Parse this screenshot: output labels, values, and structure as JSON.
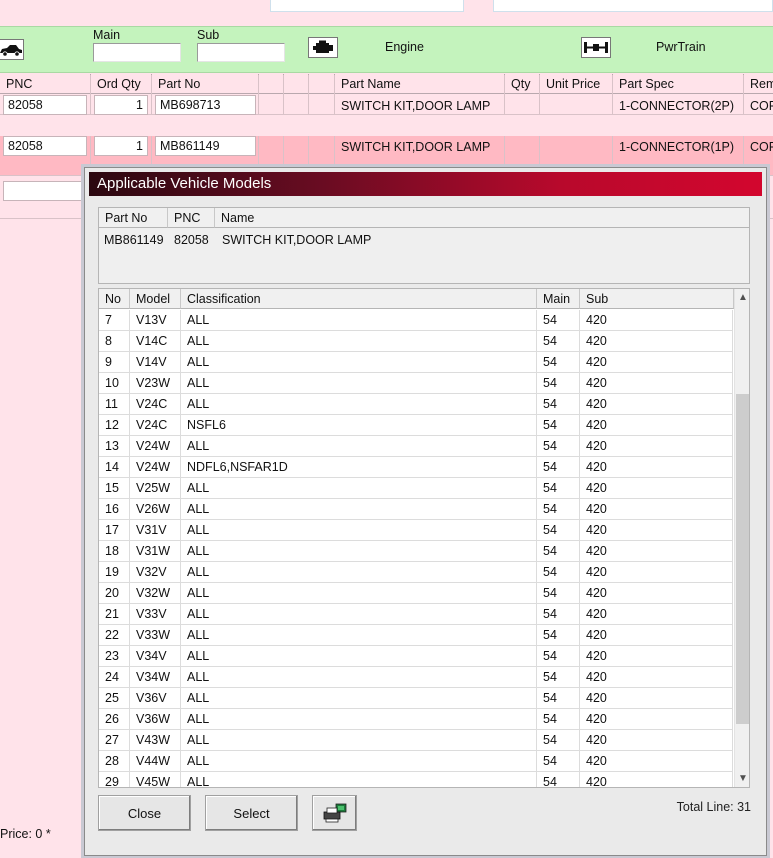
{
  "groupbar": {
    "main_label": "Main",
    "sub_label": "Sub",
    "engine_label": "Engine",
    "pwrtrain_label": "PwrTrain",
    "icons": [
      "car-icon",
      "engine-icon",
      "axle-icon"
    ]
  },
  "grid": {
    "headers": [
      "PNC",
      "Ord Qty",
      "Part No",
      "",
      "",
      "",
      "Part Name",
      "Qty",
      "Unit Price",
      "Part Spec",
      "Rem"
    ],
    "rows": [
      {
        "pnc": "82058",
        "ord_qty": "1",
        "part_no": "MB698713",
        "part_name": "SWITCH KIT,DOOR LAMP",
        "part_spec": "1-CONNECTOR(2P)",
        "remark": "COR"
      },
      {
        "pnc": "82058",
        "ord_qty": "1",
        "part_no": "MB861149",
        "part_name": "SWITCH KIT,DOOR LAMP",
        "part_spec": "1-CONNECTOR(1P)",
        "remark": "COR"
      }
    ]
  },
  "footer": {
    "price_text": "Price: 0 *"
  },
  "dialog": {
    "title": "Applicable Vehicle Models",
    "info_headers": [
      "Part No",
      "PNC",
      "Name"
    ],
    "info_values": {
      "part_no": "MB861149",
      "pnc": "82058",
      "name": "SWITCH KIT,DOOR LAMP"
    },
    "list_headers": [
      "No",
      "Model",
      "Classification",
      "Main",
      "Sub"
    ],
    "rows": [
      {
        "no": "7",
        "model": "V13V",
        "classification": "ALL",
        "main": "54",
        "sub": "420"
      },
      {
        "no": "8",
        "model": "V14C",
        "classification": "ALL",
        "main": "54",
        "sub": "420"
      },
      {
        "no": "9",
        "model": "V14V",
        "classification": "ALL",
        "main": "54",
        "sub": "420"
      },
      {
        "no": "10",
        "model": "V23W",
        "classification": "ALL",
        "main": "54",
        "sub": "420"
      },
      {
        "no": "11",
        "model": "V24C",
        "classification": "ALL",
        "main": "54",
        "sub": "420"
      },
      {
        "no": "12",
        "model": "V24C",
        "classification": "NSFL6",
        "main": "54",
        "sub": "420"
      },
      {
        "no": "13",
        "model": "V24W",
        "classification": "ALL",
        "main": "54",
        "sub": "420"
      },
      {
        "no": "14",
        "model": "V24W",
        "classification": "NDFL6,NSFAR1D",
        "main": "54",
        "sub": "420"
      },
      {
        "no": "15",
        "model": "V25W",
        "classification": "ALL",
        "main": "54",
        "sub": "420"
      },
      {
        "no": "16",
        "model": "V26W",
        "classification": "ALL",
        "main": "54",
        "sub": "420"
      },
      {
        "no": "17",
        "model": "V31V",
        "classification": "ALL",
        "main": "54",
        "sub": "420"
      },
      {
        "no": "18",
        "model": "V31W",
        "classification": "ALL",
        "main": "54",
        "sub": "420"
      },
      {
        "no": "19",
        "model": "V32V",
        "classification": "ALL",
        "main": "54",
        "sub": "420"
      },
      {
        "no": "20",
        "model": "V32W",
        "classification": "ALL",
        "main": "54",
        "sub": "420"
      },
      {
        "no": "21",
        "model": "V33V",
        "classification": "ALL",
        "main": "54",
        "sub": "420"
      },
      {
        "no": "22",
        "model": "V33W",
        "classification": "ALL",
        "main": "54",
        "sub": "420"
      },
      {
        "no": "23",
        "model": "V34V",
        "classification": "ALL",
        "main": "54",
        "sub": "420"
      },
      {
        "no": "24",
        "model": "V34W",
        "classification": "ALL",
        "main": "54",
        "sub": "420"
      },
      {
        "no": "25",
        "model": "V36V",
        "classification": "ALL",
        "main": "54",
        "sub": "420"
      },
      {
        "no": "26",
        "model": "V36W",
        "classification": "ALL",
        "main": "54",
        "sub": "420"
      },
      {
        "no": "27",
        "model": "V43W",
        "classification": "ALL",
        "main": "54",
        "sub": "420"
      },
      {
        "no": "28",
        "model": "V44W",
        "classification": "ALL",
        "main": "54",
        "sub": "420"
      },
      {
        "no": "29",
        "model": "V45W",
        "classification": "ALL",
        "main": "54",
        "sub": "420"
      }
    ],
    "close_label": "Close",
    "select_label": "Select",
    "print_icon": "printer-icon",
    "total_text": "Total Line: 31",
    "colors": {
      "title_start": "#2b0810",
      "title_end": "#d3062e"
    }
  },
  "colors": {
    "background": "#ffe3ea",
    "groupbar": "#c4f3bd",
    "selected_row": "#ffb9c3"
  }
}
